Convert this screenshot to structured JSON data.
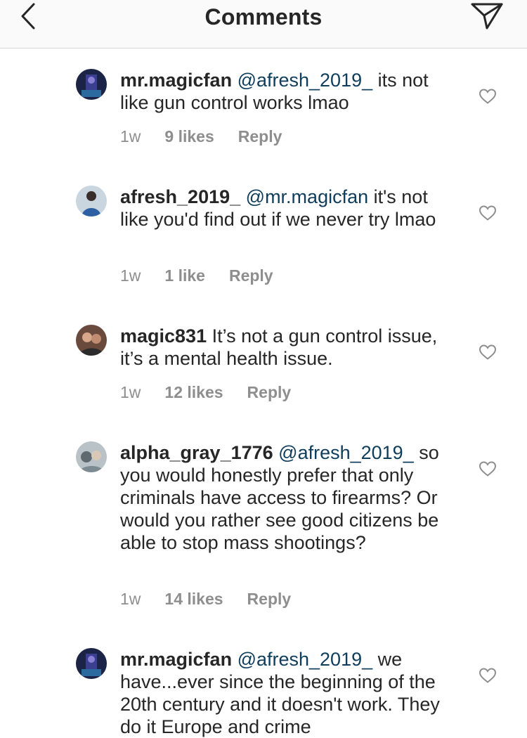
{
  "header": {
    "title": "Comments",
    "back_icon": "chevron-left-icon",
    "share_icon": "direct-send-icon"
  },
  "comments": [
    {
      "username": "mr.magicfan",
      "mention": "@afresh_2019_",
      "text": " its not like gun control works lmao",
      "time": "1w",
      "likes": "9 likes",
      "reply": "Reply"
    },
    {
      "username": "afresh_2019_",
      "mention": "@mr.magicfan",
      "text": " it's not like you'd find out if we never try lmao",
      "time": "1w",
      "likes": "1 like",
      "reply": "Reply"
    },
    {
      "username": "magic831",
      "mention": "",
      "text": " It’s not a gun control issue, it’s a mental health issue.",
      "time": "1w",
      "likes": "12 likes",
      "reply": "Reply"
    },
    {
      "username": "alpha_gray_1776",
      "mention": "@afresh_2019_",
      "text": " so you would honestly prefer that only criminals have access to firearms? Or would you rather see good citizens be able to stop mass shootings?",
      "time": "1w",
      "likes": "14 likes",
      "reply": "Reply"
    },
    {
      "username": "mr.magicfan",
      "mention": "@afresh_2019_",
      "text": " we have...ever since the beginning of the 20th century and it doesn't work. They do it Europe and crime",
      "time": "",
      "likes": "",
      "reply": ""
    }
  ],
  "colors": {
    "header_bg": "#fafafa",
    "text": "#262626",
    "mention": "#0f3d5c",
    "meta": "#8e8e8e",
    "divider": "#d4d4d4"
  }
}
